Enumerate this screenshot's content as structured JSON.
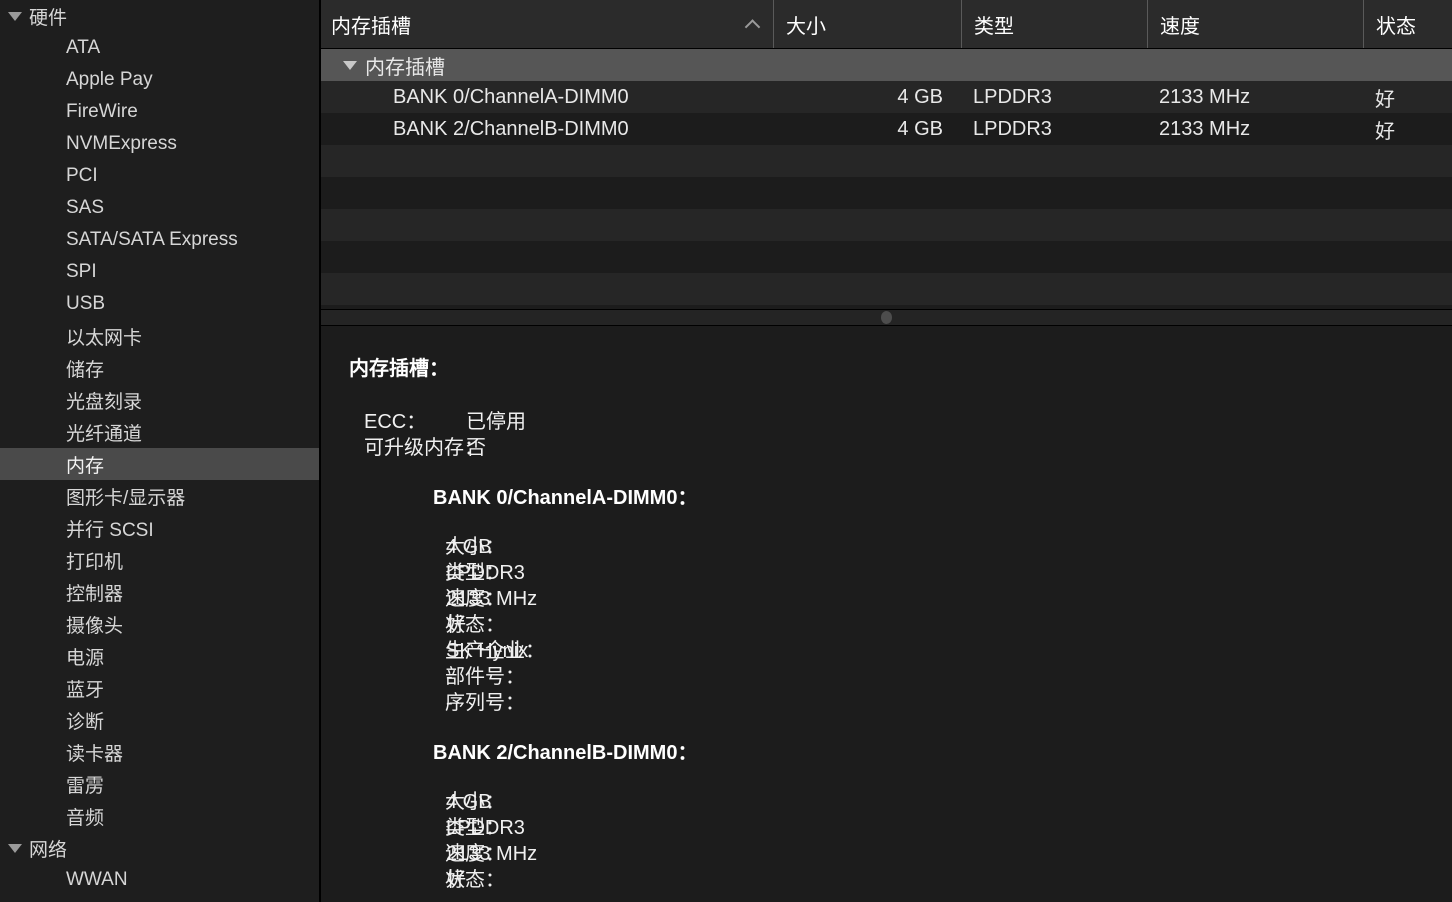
{
  "sidebar": {
    "groups": [
      {
        "label": "硬件",
        "expanded": true,
        "items": [
          {
            "label": "ATA"
          },
          {
            "label": "Apple Pay"
          },
          {
            "label": "FireWire"
          },
          {
            "label": "NVMExpress"
          },
          {
            "label": "PCI"
          },
          {
            "label": "SAS"
          },
          {
            "label": "SATA/SATA Express"
          },
          {
            "label": "SPI"
          },
          {
            "label": "USB"
          },
          {
            "label": "以太网卡"
          },
          {
            "label": "储存"
          },
          {
            "label": "光盘刻录"
          },
          {
            "label": "光纤通道"
          },
          {
            "label": "内存",
            "selected": true
          },
          {
            "label": "图形卡/显示器"
          },
          {
            "label": "并行 SCSI"
          },
          {
            "label": "打印机"
          },
          {
            "label": "控制器"
          },
          {
            "label": "摄像头"
          },
          {
            "label": "电源"
          },
          {
            "label": "蓝牙"
          },
          {
            "label": "诊断"
          },
          {
            "label": "读卡器"
          },
          {
            "label": "雷雳"
          },
          {
            "label": "音频"
          }
        ]
      },
      {
        "label": "网络",
        "expanded": true,
        "items": [
          {
            "label": "WWAN"
          }
        ]
      }
    ]
  },
  "table": {
    "columns": [
      {
        "label": "内存插槽",
        "sorted": true,
        "sort_direction": "asc"
      },
      {
        "label": "大小"
      },
      {
        "label": "类型"
      },
      {
        "label": "速度"
      },
      {
        "label": "状态"
      }
    ],
    "group_row": {
      "label": "内存插槽",
      "expanded": true
    },
    "rows": [
      {
        "name": "BANK 0/ChannelA-DIMM0",
        "size": "4 GB",
        "type": "LPDDR3",
        "speed": "2133 MHz",
        "status": "好"
      },
      {
        "name": "BANK 2/ChannelB-DIMM0",
        "size": "4 GB",
        "type": "LPDDR3",
        "speed": "2133 MHz",
        "status": "好"
      }
    ],
    "empty_row_count": 5
  },
  "detail": {
    "title": "内存插槽：",
    "top_fields": [
      {
        "key": "ECC：",
        "value": "已停用"
      },
      {
        "key": "可升级内存：",
        "value": "否"
      }
    ],
    "banks": [
      {
        "heading": "BANK 0/ChannelA-DIMM0：",
        "fields": [
          {
            "key": "大小：",
            "value": "4 GB"
          },
          {
            "key": "类型：",
            "value": "LPDDR3"
          },
          {
            "key": "速度：",
            "value": "2133 MHz"
          },
          {
            "key": "状态：",
            "value": "好"
          },
          {
            "key": "生产企业：",
            "value": "SK Hynix"
          },
          {
            "key": "部件号：",
            "value": "-"
          },
          {
            "key": "序列号：",
            "value": "-"
          }
        ]
      },
      {
        "heading": "BANK 2/ChannelB-DIMM0：",
        "fields": [
          {
            "key": "大小：",
            "value": "4 GB"
          },
          {
            "key": "类型：",
            "value": "LPDDR3"
          },
          {
            "key": "速度：",
            "value": "2133 MHz"
          },
          {
            "key": "状态：",
            "value": "好"
          }
        ]
      }
    ]
  },
  "colors": {
    "window_bg": "#1c1c1c",
    "sidebar_bg": "#1e1e1e",
    "selection": "#4a4a4a",
    "header_bg": "#2b2b2b",
    "group_row_bg": "#565656",
    "row_stripe": "#262626",
    "text": "#e8e8e8"
  }
}
